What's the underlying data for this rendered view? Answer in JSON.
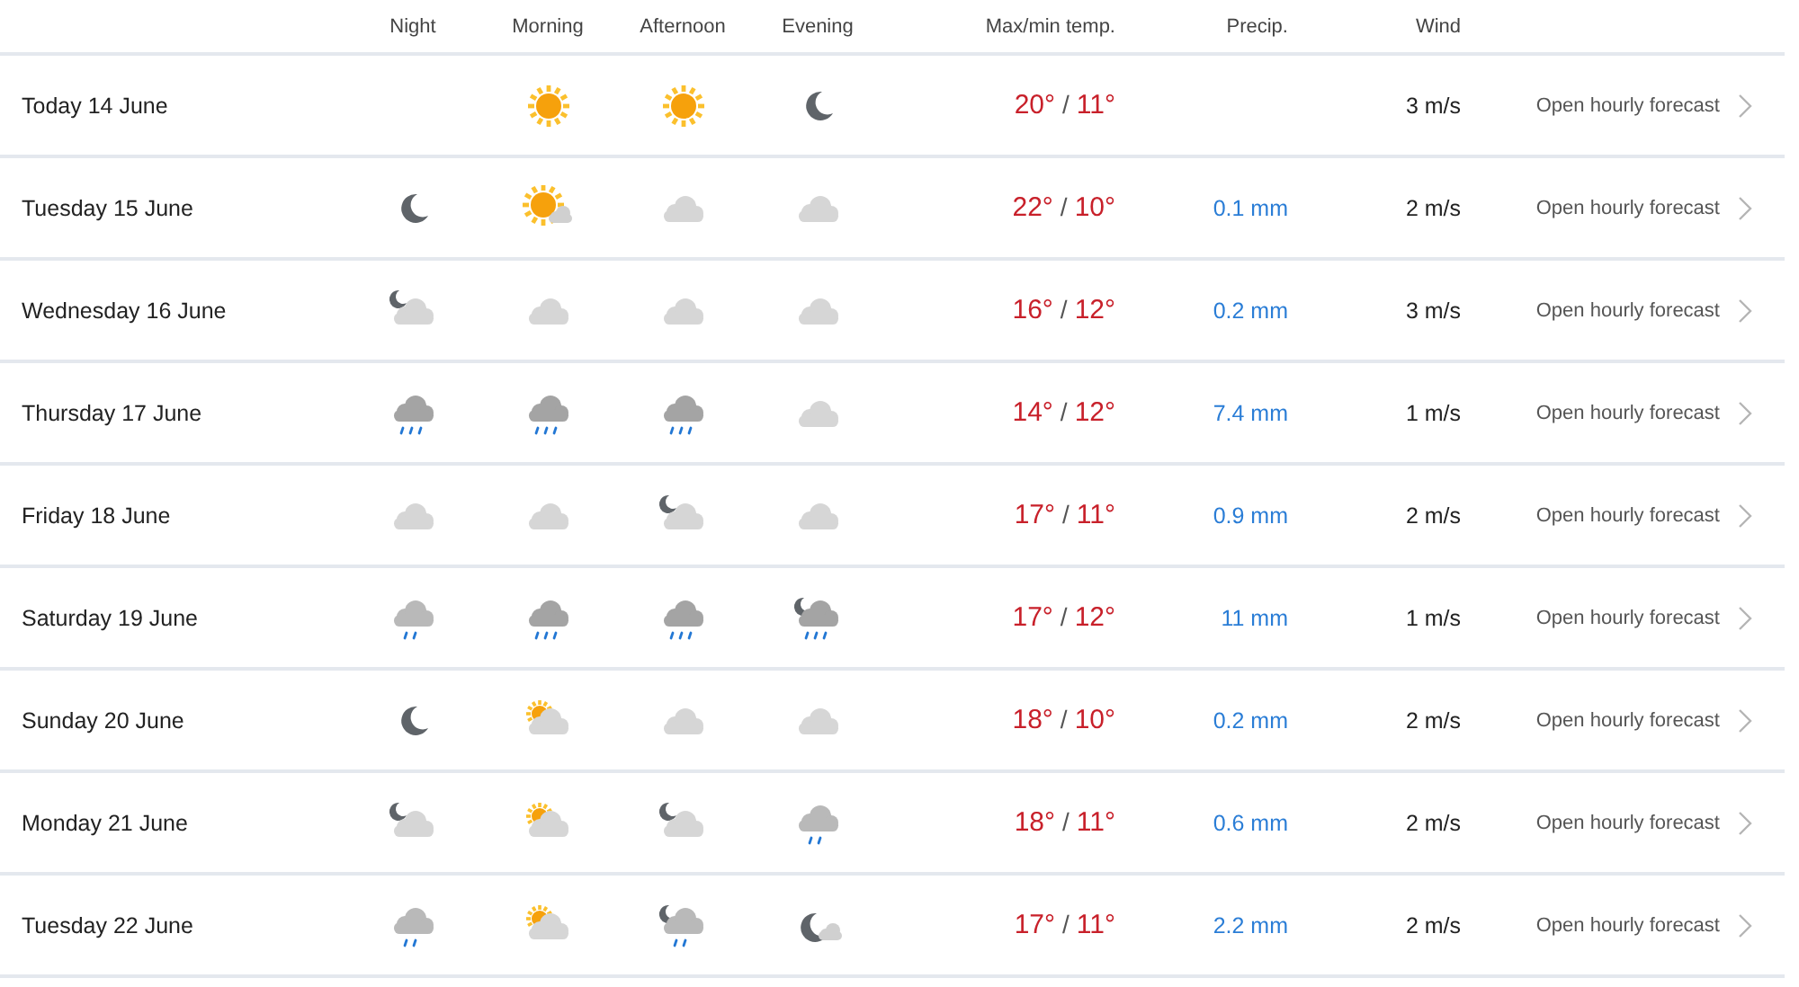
{
  "columns": [
    "Night",
    "Morning",
    "Afternoon",
    "Evening",
    "Max/min temp.",
    "Precip.",
    "Wind"
  ],
  "rows": [
    {
      "day": "Today 14 June",
      "morning": {
        "kind": "sun"
      },
      "afternoon": {
        "kind": "sun"
      },
      "evening": {
        "kind": "moon"
      },
      "temp": [
        "20°",
        "/",
        "11°"
      ],
      "wind": "3 m/s",
      "link": "Open hourly forecast"
    },
    {
      "day": "Tuesday 15 June",
      "night": {
        "kind": "moon"
      },
      "morning": {
        "kind": "sun_cloud"
      },
      "afternoon": {
        "kind": "cloud"
      },
      "evening": {
        "kind": "cloud"
      },
      "temp": [
        "22°",
        "/",
        "10°"
      ],
      "precip": "0.1 mm",
      "wind": "2 m/s",
      "link": "Open hourly forecast"
    },
    {
      "day": "Wednesday 16 June",
      "night": {
        "kind": "moon_cloud"
      },
      "morning": {
        "kind": "cloud"
      },
      "afternoon": {
        "kind": "cloud"
      },
      "evening": {
        "kind": "cloud"
      },
      "temp": [
        "16°",
        "/",
        "12°"
      ],
      "precip": "0.2 mm",
      "wind": "3 m/s",
      "link": "Open hourly forecast"
    },
    {
      "day": "Thursday 17 June",
      "night": {
        "kind": "rain"
      },
      "morning": {
        "kind": "rain"
      },
      "afternoon": {
        "kind": "rain"
      },
      "evening": {
        "kind": "cloud"
      },
      "temp": [
        "14°",
        "/",
        "12°"
      ],
      "precip": "7.4 mm",
      "wind": "1 m/s",
      "link": "Open hourly forecast"
    },
    {
      "day": "Friday 18 June",
      "night": {
        "kind": "cloud"
      },
      "morning": {
        "kind": "cloud"
      },
      "afternoon": {
        "kind": "moon_cloud"
      },
      "evening": {
        "kind": "cloud"
      },
      "temp": [
        "17°",
        "/",
        "11°"
      ],
      "precip": "0.9 mm",
      "wind": "2 m/s",
      "link": "Open hourly forecast"
    },
    {
      "day": "Saturday 19 June",
      "night": {
        "kind": "light_rain"
      },
      "morning": {
        "kind": "rain"
      },
      "afternoon": {
        "kind": "rain"
      },
      "evening": {
        "kind": "moon_rain"
      },
      "temp": [
        "17°",
        "/",
        "12°"
      ],
      "precip": "11 mm",
      "wind": "1 m/s",
      "link": "Open hourly forecast"
    },
    {
      "day": "Sunday 20 June",
      "night": {
        "kind": "moon"
      },
      "morning": {
        "kind": "partly_cloudy"
      },
      "afternoon": {
        "kind": "cloud"
      },
      "evening": {
        "kind": "cloud"
      },
      "temp": [
        "18°",
        "/",
        "10°"
      ],
      "precip": "0.2 mm",
      "wind": "2 m/s",
      "link": "Open hourly forecast"
    },
    {
      "day": "Monday 21 June",
      "night": {
        "kind": "moon_cloud"
      },
      "morning": {
        "kind": "partly_cloudy"
      },
      "afternoon": {
        "kind": "moon_cloud"
      },
      "evening": {
        "kind": "light_rain"
      },
      "temp": [
        "18°",
        "/",
        "11°"
      ],
      "precip": "0.6 mm",
      "wind": "2 m/s",
      "link": "Open hourly forecast"
    },
    {
      "day": "Tuesday 22 June",
      "night": {
        "kind": "light_rain"
      },
      "morning": {
        "kind": "partly_cloudy"
      },
      "afternoon": {
        "kind": "moon_light_rain"
      },
      "evening": {
        "kind": "moon_small_cloud"
      },
      "temp": [
        "17°",
        "/",
        "11°"
      ],
      "precip": "2.2 mm",
      "wind": "2 m/s",
      "link": "Open hourly forecast"
    }
  ]
}
